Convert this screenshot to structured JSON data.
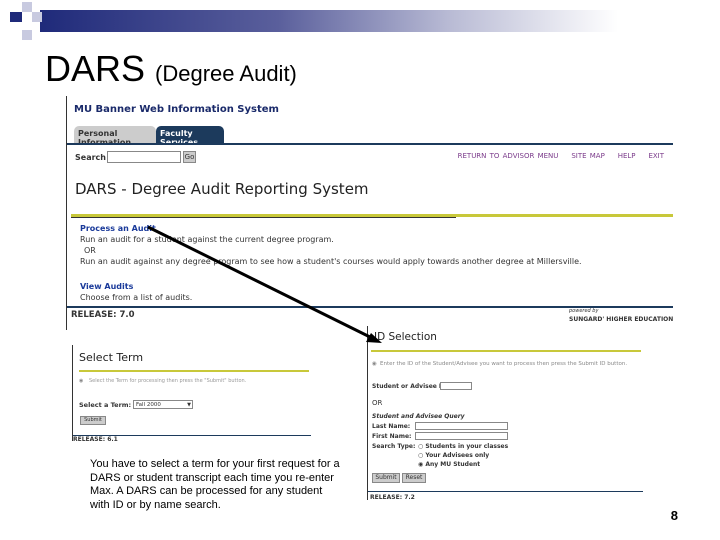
{
  "slide": {
    "title": "DARS",
    "subtitle": "(Degree Audit)",
    "caption": "You have to select a term for your first request for a DARS or student transcript each time you re-enter Max.  A DARS can be processed for any student with ID or by name search.",
    "page_number": "8"
  },
  "main": {
    "system_title": "MU Banner Web Information System",
    "tabs": [
      "Personal Information",
      "Faculty Services"
    ],
    "search_label": "Search",
    "search_value": "",
    "go_label": "Go",
    "links": [
      "RETURN TO ADVISOR MENU",
      "SITE MAP",
      "HELP",
      "EXIT"
    ],
    "heading": "DARS - Degree Audit Reporting System",
    "process_link": "Process an Audit",
    "process_desc1": "Run an audit for a student against the current degree program.",
    "or": "OR",
    "process_desc2": "Run an audit against any degree program to see how a student's courses would apply towards another degree at Millersville.",
    "view_link": "View Audits",
    "view_desc": "Choose from a list of audits.",
    "release": "RELEASE: 7.0",
    "powered_by": "powered by",
    "sungard": "SUNGARD' HIGHER EDUCATION"
  },
  "term": {
    "heading": "Select Term",
    "instruction": "Select the Term for processing then press the \"Submit\" button.",
    "label": "Select a Term:",
    "selected": "Fall 2000",
    "submit": "Submit",
    "release": "RELEASE: 6.1"
  },
  "id_sel": {
    "heading": "ID Selection",
    "instruction": "Enter the ID of the Student/Advisee you want to process then press the Submit ID button.",
    "id_label": "Student or Advisee ID:",
    "or": "OR",
    "query_label": "Student and Advisee Query",
    "last_name": "Last Name:",
    "first_name": "First Name:",
    "search_type": "Search Type:",
    "options": [
      "Students in your classes",
      "Your Advisees only",
      "Any MU Student"
    ],
    "selected_option": 2,
    "submit": "Submit",
    "reset": "Reset",
    "release": "RELEASE: 7.2"
  },
  "colors": {
    "navy": "#1c3a5c",
    "yellow": "#c8c83a",
    "band": "#1f2a7a"
  }
}
